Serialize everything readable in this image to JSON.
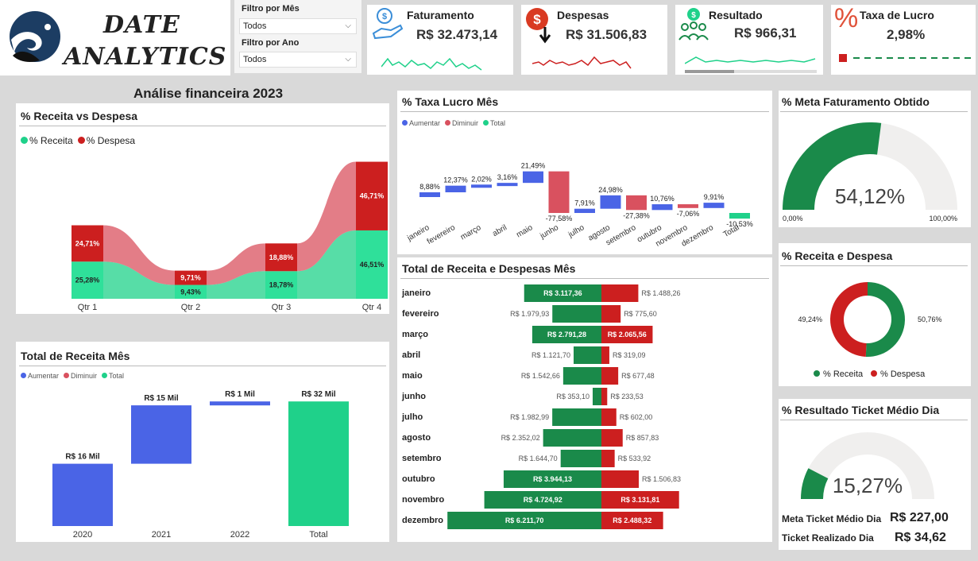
{
  "brand": {
    "line1": "DATE",
    "line2": "ANALYTICS"
  },
  "filters": {
    "month_label": "Filtro por Mês",
    "month_value": "Todos",
    "year_label": "Filtro por Ano",
    "year_value": "Todos"
  },
  "kpis": {
    "faturamento": {
      "label": "Faturamento",
      "value": "R$ 32.473,14"
    },
    "despesas": {
      "label": "Despesas",
      "value": "R$ 31.506,83"
    },
    "resultado": {
      "label": "Resultado",
      "value": "R$ 966,31"
    },
    "taxa": {
      "label": "Taxa de  Lucro",
      "value": "2,98%",
      "symbol": "%"
    }
  },
  "page_title": "Análise financeira 2023",
  "colors": {
    "green": "#1a8a4a",
    "red": "#cc1f1f",
    "blue": "#4a64e6",
    "teal": "#1fd18a",
    "rose": "#d9515f"
  },
  "receita_despesa": {
    "title": "% Receita vs Despesa",
    "legend": [
      "% Receita",
      "% Despesa"
    ],
    "chart_data": {
      "type": "area",
      "categories": [
        "Qtr 1",
        "Qtr 2",
        "Qtr 3",
        "Qtr 4"
      ],
      "series": [
        {
          "name": "% Receita",
          "values": [
            25.28,
            9.43,
            18.78,
            46.51
          ],
          "labels": [
            "25,28%",
            "9,43%",
            "18,78%",
            "46,51%"
          ]
        },
        {
          "name": "% Despesa",
          "values": [
            24.71,
            9.71,
            18.88,
            46.71
          ],
          "labels": [
            "24,71%",
            "9,71%",
            "18,88%",
            "46,71%"
          ]
        }
      ]
    }
  },
  "taxa_lucro_mes": {
    "title": "% Taxa Lucro Mês",
    "legend": [
      "Aumentar",
      "Diminuir",
      "Total"
    ],
    "chart_data": {
      "type": "bar",
      "categories": [
        "janeiro",
        "fevereiro",
        "março",
        "abril",
        "maio",
        "junho",
        "julho",
        "agosto",
        "setembro",
        "outubro",
        "novembro",
        "dezembro",
        "Total"
      ],
      "values": [
        8.88,
        12.37,
        2.02,
        3.16,
        21.49,
        -77.58,
        7.91,
        24.98,
        -27.38,
        10.76,
        -7.06,
        9.91,
        -10.53
      ],
      "labels": [
        "8,88%",
        "12,37%",
        "2,02%",
        "3,16%",
        "21,49%",
        "-77,58%",
        "7,91%",
        "24,98%",
        "-27,38%",
        "10,76%",
        "-7,06%",
        "9,91%",
        "-10,53%"
      ]
    }
  },
  "receita_despesa_mes": {
    "title": "Total de Receita e Despesas Mês",
    "chart_data": {
      "type": "bar",
      "categories": [
        "janeiro",
        "fevereiro",
        "março",
        "abril",
        "maio",
        "junho",
        "julho",
        "agosto",
        "setembro",
        "outubro",
        "novembro",
        "dezembro"
      ],
      "series": [
        {
          "name": "Receita",
          "values": [
            3117.36,
            1979.93,
            2791.28,
            1121.7,
            1542.66,
            353.1,
            1982.99,
            2352.02,
            1644.7,
            3944.13,
            4724.92,
            6211.7
          ],
          "labels": [
            "R$ 3.117,36",
            "R$ 1.979,93",
            "R$ 2.791,28",
            "R$ 1.121,70",
            "R$ 1.542,66",
            "R$ 353,10",
            "R$ 1.982,99",
            "R$ 2.352,02",
            "R$ 1.644,70",
            "R$ 3.944,13",
            "R$ 4.724,92",
            "R$ 6.211,70"
          ]
        },
        {
          "name": "Despesa",
          "values": [
            1488.26,
            775.6,
            2065.56,
            319.09,
            677.48,
            233.53,
            602.0,
            857.83,
            533.92,
            1506.83,
            3131.81,
            2488.32
          ],
          "labels": [
            "R$ 1.488,26",
            "R$ 775,60",
            "R$ 2.065,56",
            "R$ 319,09",
            "R$ 677,48",
            "R$ 233,53",
            "R$ 602,00",
            "R$ 857,83",
            "R$ 533,92",
            "R$ 1.506,83",
            "R$ 3.131,81",
            "R$ 2.488,32"
          ]
        }
      ]
    }
  },
  "receita_mes": {
    "title": "Total de Receita Mês",
    "legend": [
      "Aumentar",
      "Diminuir",
      "Total"
    ],
    "chart_data": {
      "type": "bar",
      "categories": [
        "2020",
        "2021",
        "2022",
        "Total"
      ],
      "values": [
        16,
        15,
        1,
        32
      ],
      "labels": [
        "R$ 16 Mil",
        "R$ 15 Mil",
        "R$ 1 Mil",
        "R$ 32 Mil"
      ]
    }
  },
  "meta_fat": {
    "title": "% Meta Faturamento Obtido",
    "value": 54.12,
    "value_label": "54,12%",
    "min_label": "0,00%",
    "max_label": "100,00%"
  },
  "receita_despesa_donut": {
    "title": "% Receita e Despesa",
    "chart_data": {
      "type": "pie",
      "categories": [
        "% Receita",
        "% Despesa"
      ],
      "values": [
        50.76,
        49.24
      ],
      "labels": [
        "50,76%",
        "49,24%"
      ]
    }
  },
  "ticket": {
    "title": "% Resultado Ticket Médio Dia",
    "value": 15.27,
    "value_label": "15,27%",
    "meta_label": "Meta Ticket Médio Dia",
    "meta_value": "R$ 227,00",
    "real_label": "Ticket Realizado Dia",
    "real_value": "R$ 34,62"
  }
}
